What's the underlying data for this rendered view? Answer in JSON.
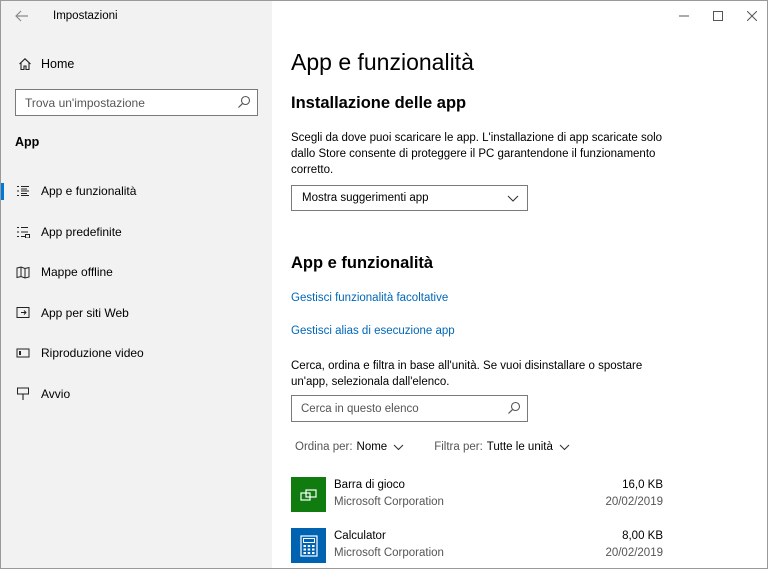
{
  "window": {
    "title": "Impostazioni",
    "controls": {
      "minimize": "—",
      "maximize": "☐",
      "close": "✕"
    }
  },
  "sidebar": {
    "home_label": "Home",
    "search_placeholder": "Trova un'impostazione",
    "section_label": "App",
    "items": [
      {
        "label": "App e funzionalità",
        "icon": "apps-features-icon",
        "active": true
      },
      {
        "label": "App predefinite",
        "icon": "default-apps-icon",
        "active": false
      },
      {
        "label": "Mappe offline",
        "icon": "offline-maps-icon",
        "active": false
      },
      {
        "label": "App per siti Web",
        "icon": "apps-websites-icon",
        "active": false
      },
      {
        "label": "Riproduzione video",
        "icon": "video-playback-icon",
        "active": false
      },
      {
        "label": "Avvio",
        "icon": "startup-icon",
        "active": false
      }
    ]
  },
  "main": {
    "page_title": "App e funzionalità",
    "install_heading": "Installazione delle app",
    "install_description": "Scegli da dove puoi scaricare le app. L'installazione di app scaricate solo dallo Store consente di proteggere il PC garantendone il funzionamento corretto.",
    "install_dropdown_value": "Mostra suggerimenti app",
    "features_heading": "App e funzionalità",
    "link_optional_features": "Gestisci funzionalità facoltative",
    "link_execution_alias": "Gestisci alias di esecuzione app",
    "list_description": "Cerca, ordina e filtra in base all'unità. Se vuoi disinstallare o spostare un'app, selezionala dall'elenco.",
    "list_search_placeholder": "Cerca in questo elenco",
    "sort_label": "Ordina per:",
    "sort_value": "Nome",
    "filter_label": "Filtra per:",
    "filter_value": "Tutte le unità",
    "apps": [
      {
        "name": "Barra di gioco",
        "publisher": "Microsoft Corporation",
        "size": "16,0 KB",
        "date": "20/02/2019",
        "tile_color": "#107c10",
        "icon": "game-bar-icon"
      },
      {
        "name": "Calculator",
        "publisher": "Microsoft Corporation",
        "size": "8,00 KB",
        "date": "20/02/2019",
        "tile_color": "#0063b1",
        "icon": "calculator-icon"
      }
    ]
  },
  "colors": {
    "accent": "#0078d7",
    "link": "#0067b8",
    "sidebar_bg": "#f2f2f2"
  }
}
